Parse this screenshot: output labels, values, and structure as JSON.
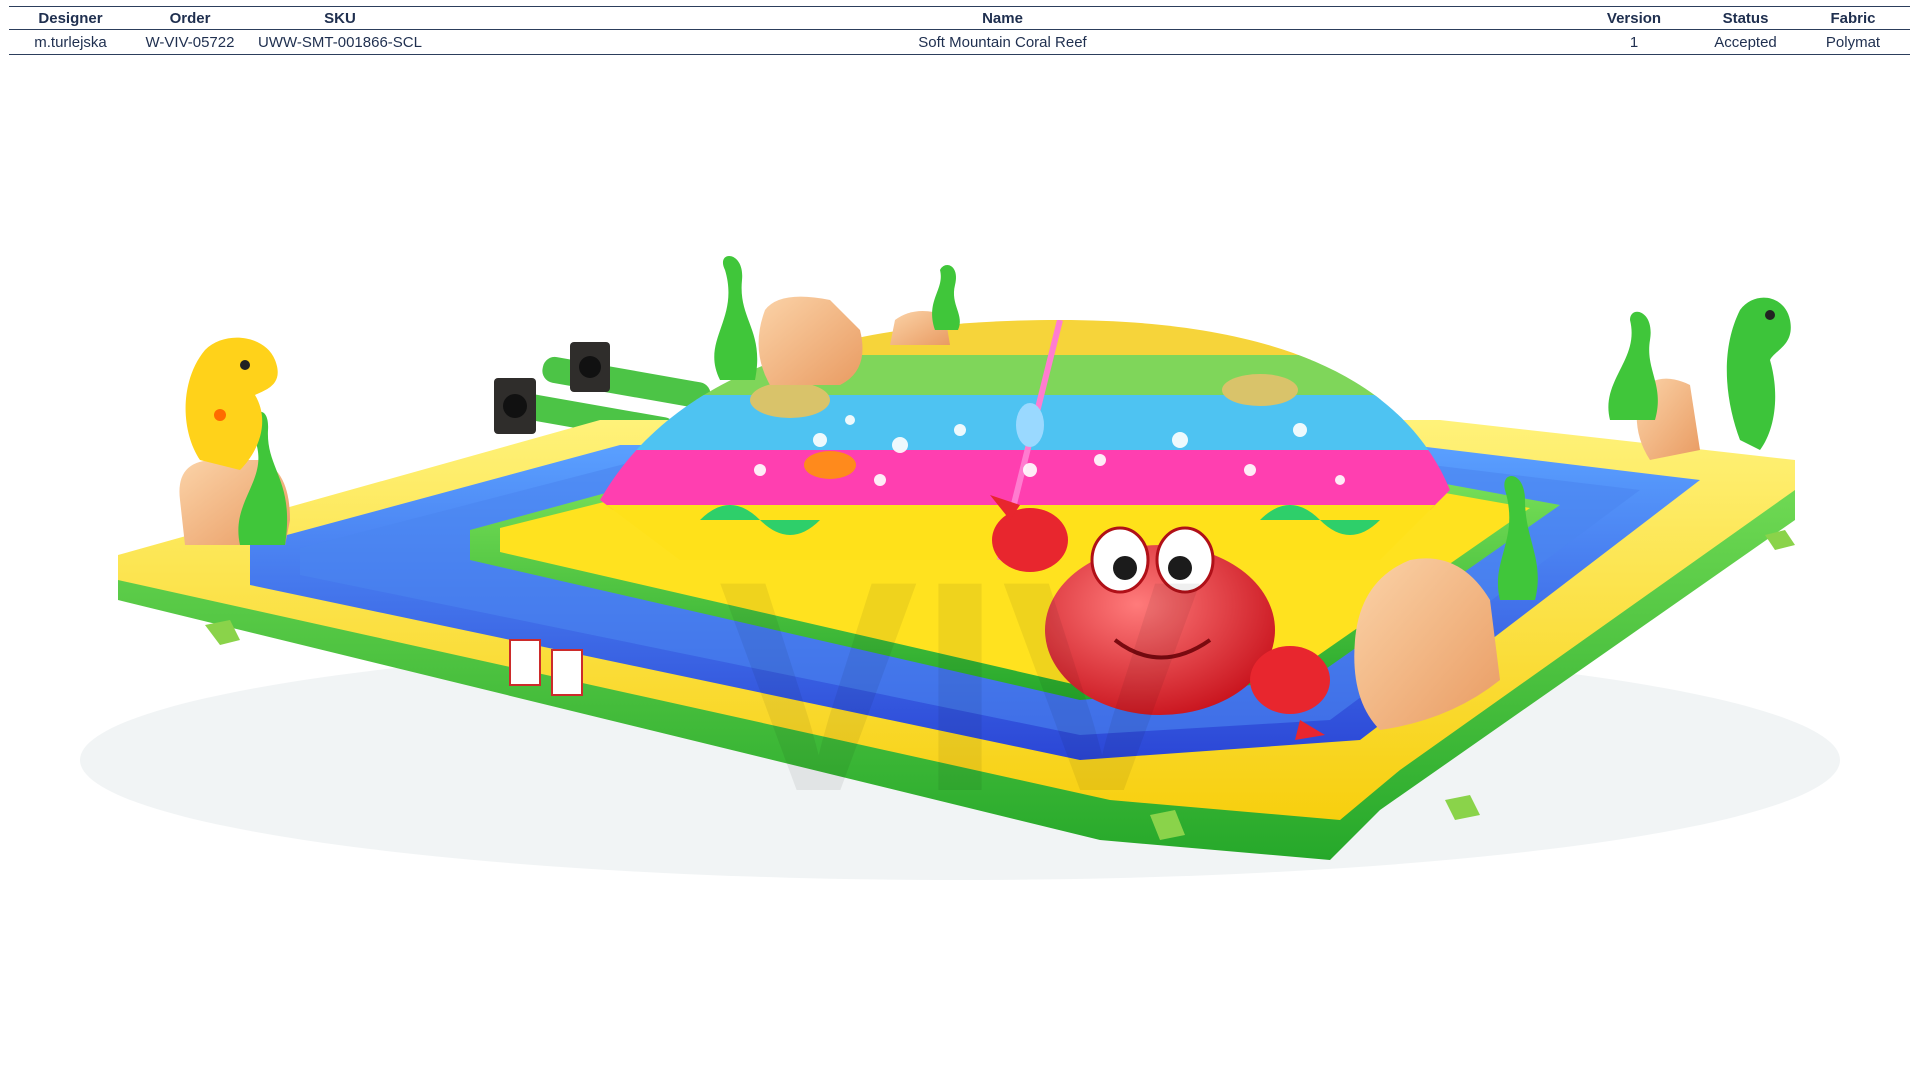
{
  "header": {
    "columns": [
      "Designer",
      "Order",
      "SKU",
      "Name",
      "Version",
      "Status",
      "Fabric"
    ]
  },
  "record": {
    "designer": "m.turlejska",
    "order": "W-VIV-05722",
    "sku": "UWW-SMT-001866-SCL",
    "name": "Soft Mountain Coral Reef",
    "version": "1",
    "status": "Accepted",
    "fabric": "Polymat"
  },
  "render": {
    "watermark": "VIV",
    "colors": {
      "frame_green": "#3fc43c",
      "frame_yellow": "#ffe11a",
      "lane_blue": "#3a64e6",
      "dome_pink": "#ff3fb0",
      "dome_cyan": "#4ec3f2",
      "crab_red": "#e8262e",
      "rock_peach": "#f3b27c"
    }
  }
}
